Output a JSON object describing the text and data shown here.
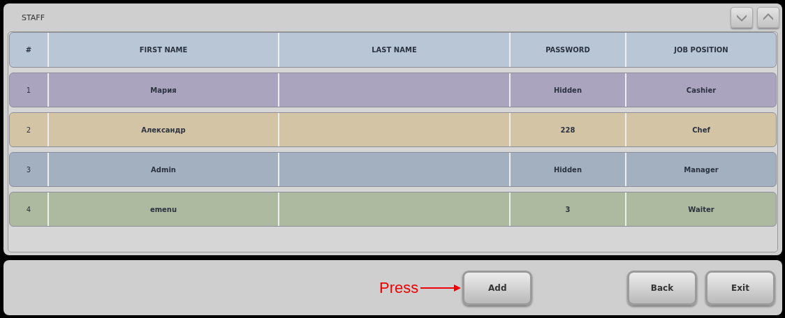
{
  "panel": {
    "title": "STAFF"
  },
  "table": {
    "columns": [
      "#",
      "FIRST NAME",
      "LAST NAME",
      "PASSWORD",
      "JOB POSITION"
    ],
    "rows": [
      {
        "cells": [
          "1",
          "Мария",
          "",
          "Hidden",
          "Cashier"
        ],
        "color": "#aaa4bf"
      },
      {
        "cells": [
          "2",
          "Александр",
          "",
          "228",
          "Chef"
        ],
        "color": "#d3c4a6"
      },
      {
        "cells": [
          "3",
          "Admin",
          "",
          "Hidden",
          "Manager"
        ],
        "color": "#a3b0c0"
      },
      {
        "cells": [
          "4",
          "emenu",
          "",
          "3",
          "Waiter"
        ],
        "color": "#aebaa0"
      }
    ]
  },
  "annotation": {
    "text": "Press"
  },
  "buttons": [
    "Add",
    "Back",
    "Exit"
  ]
}
